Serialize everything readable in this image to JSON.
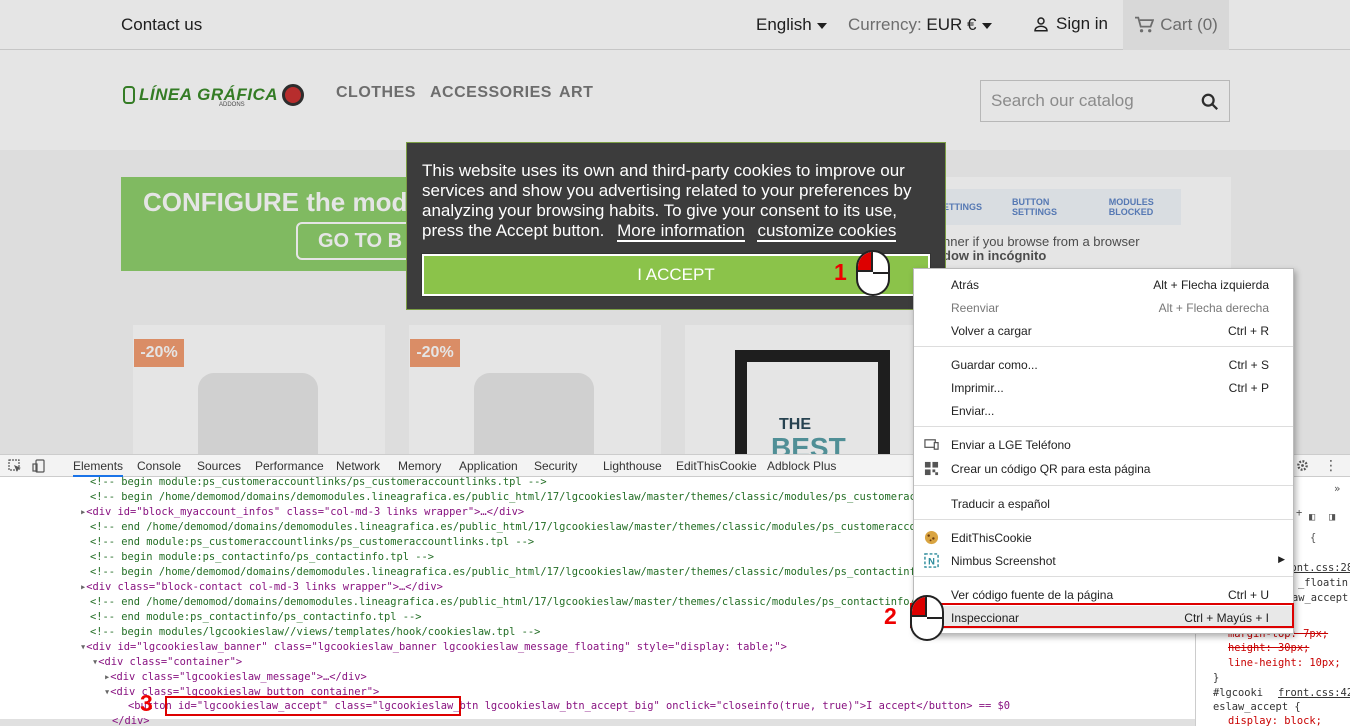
{
  "topbar": {
    "contact": "Contact us",
    "language": "English",
    "currency_label": "Currency:",
    "currency_value": "EUR €",
    "signin": "Sign in",
    "cart": "Cart (0)"
  },
  "header": {
    "logo_text": "LÍNEA GRÁFICA",
    "logo_sub": "ADDONS",
    "nav": [
      "CLOTHES",
      "ACCESSORIES",
      "ART"
    ],
    "search_placeholder": "Search our catalog"
  },
  "banner": {
    "title": "CONFIGURE the mod",
    "go": "GO TO B",
    "tabs": [
      "ETTINGS",
      "BUTTON SETTINGS",
      "MODULES BLOCKED"
    ],
    "note_line1": "nner if you browse from a browser",
    "note_line2": "dow in incógnito"
  },
  "products": [
    {
      "discount": "-20%"
    },
    {
      "discount": "-20%"
    },
    {
      "line1": "THE",
      "line2": "BEST"
    }
  ],
  "cookie": {
    "message": "This website uses its own and third-party cookies to improve our services and show you advertising related to your preferences by analyzing your browsing habits. To give your consent to its use, press the Accept button.",
    "more_info": "More information",
    "customize": "customize cookies",
    "accept": "I ACCEPT"
  },
  "markers": {
    "m1": "1",
    "m2": "2",
    "m3": "3"
  },
  "context_menu": {
    "items": [
      {
        "label": "Atrás",
        "shortcut": "Alt + Flecha izquierda"
      },
      {
        "label": "Reenviar",
        "shortcut": "Alt + Flecha derecha"
      },
      {
        "label": "Volver a cargar",
        "shortcut": "Ctrl + R"
      },
      {
        "label": "Guardar como...",
        "shortcut": "Ctrl + S"
      },
      {
        "label": "Imprimir...",
        "shortcut": "Ctrl + P"
      },
      {
        "label": "Enviar..."
      },
      {
        "label": "Enviar a LGE Teléfono"
      },
      {
        "label": "Crear un código QR para esta página"
      },
      {
        "label": "Traducir a español"
      },
      {
        "label": "EditThisCookie"
      },
      {
        "label": "Nimbus Screenshot"
      },
      {
        "label": "Ver código fuente de la página",
        "shortcut": "Ctrl + U"
      },
      {
        "label": "Inspeccionar",
        "shortcut": "Ctrl + Mayús + I"
      }
    ]
  },
  "devtools": {
    "tabs": [
      "Elements",
      "Console",
      "Sources",
      "Performance",
      "Network",
      "Memory",
      "Application",
      "Security",
      "Lighthouse",
      "EditThisCookie",
      "Adblock Plus"
    ],
    "dom_lines": [
      "<!-- begin module:ps_customeraccountlinks/ps_customeraccountlinks.tpl -->",
      "<!-- begin /home/demomod/domains/demomodules.lineagrafica.es/public_html/17/lgcookieslaw/master/themes/classic/modules/ps_customeraccountlin",
      "<div id=\"block_myaccount_infos\" class=\"col-md-3 links wrapper\">…</div>",
      "<!-- end /home/demomod/domains/demomodules.lineagrafica.es/public_html/17/lgcookieslaw/master/themes/classic/modules/ps_customeraccountlinks",
      "<!-- end module:ps_customeraccountlinks/ps_customeraccountlinks.tpl -->",
      "<!-- begin module:ps_contactinfo/ps_contactinfo.tpl -->",
      "<!-- begin /home/demomod/domains/demomodules.lineagrafica.es/public_html/17/lgcookieslaw/master/themes/classic/modules/ps_contactinfo/ps_con",
      "<div class=\"block-contact col-md-3 links wrapper\">…</div>",
      "<!-- end /home/demomod/domains/demomodules.lineagrafica.es/public_html/17/lgcookieslaw/master/themes/classic/modules/ps_contactinfo/ps_cont",
      "<!-- end module:ps_contactinfo/ps_contactinfo.tpl -->",
      "<!-- begin modules/lgcookieslaw//views/templates/hook/cookieslaw.tpl -->",
      "<div id=\"lgcookieslaw_banner\" class=\"lgcookieslaw_banner  lgcookieslaw_message_floating\" style=\"display: table;\">",
      "<div class=\"container\">",
      "<div class=\"lgcookieslaw_message\">…</div>",
      "<div class=\"lgcookieslaw_button_container\">",
      "<button id=\"lgcookieslaw_accept\" class=\"lgcookieslaw_btn lgcookieslaw_btn_accept_big\" onclick=\"closeinfo(true, true)\">I accept</button> == $0",
      "</div>"
    ],
    "styles_lines": [
      "ated",
      "front.css:289",
      "_floatin",
      "aw_accept",
      "{",
      "margin-top: 7px;",
      "height: 30px;",
      "line-height: 10px;",
      "}",
      "#lgcooki",
      "front.css:42",
      "eslaw_accept {",
      "display: block;"
    ]
  },
  "colors": {
    "cookie_bg": "#3c3c3c",
    "accept_green": "#8bc34a",
    "marker_red": "#dd0000",
    "brand_green": "#3a8b2a"
  }
}
